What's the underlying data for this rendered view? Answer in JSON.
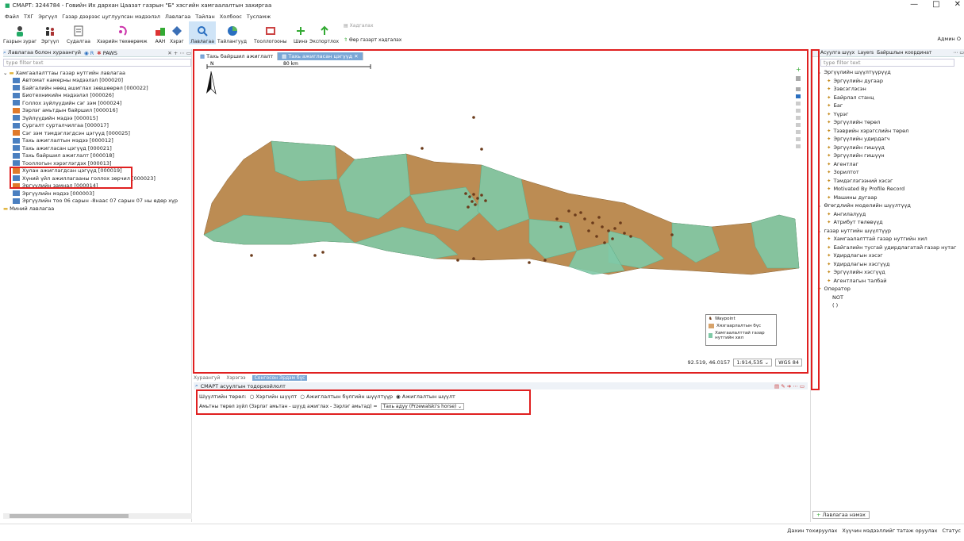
{
  "title": "СМАРТ: 3244784 - Говийн Их дархан Цаазат газрын \"Б\" хэсгийн хамгаалалтын захиргаа",
  "window_controls": [
    "—",
    "□",
    "✕"
  ],
  "menu": [
    "Файл",
    "ТХГ",
    "Эргүүл",
    "Газар дээрээс цуглуулсан мэдээлэл",
    "Лавлагаа",
    "Тайлан",
    "Холбоос",
    "Тусламж"
  ],
  "toolbar": [
    {
      "label": "Газрын зураг",
      "icon": "person-icon"
    },
    {
      "label": "Эргүүл",
      "icon": "patrol-icon"
    },
    {
      "label": "Судалгаа",
      "icon": "survey-icon"
    },
    {
      "label": "Хээрийн төхөөрөмж",
      "icon": "device-icon"
    },
    {
      "label": "ААН",
      "icon": "org-icon"
    },
    {
      "label": "Хэрэг",
      "icon": "case-icon"
    },
    {
      "label": "Лавлагаа",
      "icon": "search-icon"
    },
    {
      "label": "Тайлангууд",
      "icon": "pie-icon"
    },
    {
      "label": "Тооллогооны",
      "icon": "count-icon"
    },
    {
      "label": "Шинэ",
      "icon": "plus-icon"
    },
    {
      "label": "Экспортлох",
      "icon": "export-icon"
    },
    {
      "label": "Хадгалах",
      "icon": "save-icon"
    },
    {
      "label": "Өөр газарт хадгалах",
      "icon": "save-as-icon"
    }
  ],
  "admin_label": "Админ О",
  "left": {
    "tab_label": "Лавлагаа болон хураангүй",
    "tab2_label": "R",
    "tab3_label": "PAWS",
    "filter_placeholder": "type filter text",
    "root": "Хамгаалалттаы газар нутгийн лавлагаа",
    "items": [
      "Автомат камерны мэдээлэл [000020]",
      "Байгалийн нөөц ашиглах зөвшөөрөл [000022]",
      "Биотехникийн мэдээлэл [000026]",
      "Голлох зүйлүүдийн сэг зэм [000024]",
      "Зэрлэг амьтдын байршил [000016]",
      "Зүйлүүдийн мэдээ [000015]",
      "Сургалт сурталчилгаа [000017]",
      "Сэг зэм тэмдэглэгдсэн цэгүүд [000025]",
      "Тахь ажиглалтын мэдээ [000012]",
      "Тахь ажигласан цэгүүд [000021]",
      "Тахь байршил ажиглалт [000018]",
      "Тооллогын хэрэглэгдэх [000013]",
      "Хулан ажиглагдсан цэгүүд [000019]",
      "Хүний үйл ажиллагааны голлох зөрчил [000023]",
      "Эргүүлийн замнал [000014]",
      "Эргүүлийн мэдээ [000003]",
      "Эргүүлийн тоо 06 сарын -8наас 07 сарын 07 ны өдөр хүр"
    ],
    "my_queries": "Миний лавлагаа"
  },
  "map": {
    "tabs": [
      "Тахь байршил ажиглалт",
      "Тахь ажигласан цэгүүд"
    ],
    "scale_label": "80 km",
    "north_label": "N",
    "coords": "92.519, 46.0157",
    "scale": "1:914,535",
    "crs": "WGS 84",
    "legend": [
      {
        "label": "Waypoint",
        "color": "#6b3b1b"
      },
      {
        "label": "Хязгаарлалтын бүс",
        "color": "#d7a36b"
      },
      {
        "label": "Хамгаалалттай газар нутгийн хил",
        "color": "#7fc9a6"
      }
    ]
  },
  "bottom": {
    "tabs": [
      "Хураангуй",
      "Хэрэгээ",
      "Сонгосон Эрдэм бүс"
    ],
    "section_title": "СМАРТ асуулгын тодорхойлолт",
    "radio_label": "Шүүлтийн төрөл:",
    "radios": [
      "Хэргийн шүүлт",
      "Ажиглалтын бүлгийн шүүлтүүр",
      "Ажиглалтын шүүлт"
    ],
    "filter_text": "Амьтны төрөл зүйл (Зэрлэг амьтан - шууд ажиглах - Зэрлэг амьтад) =",
    "filter_value": "Тахь адуу (Przewalski's horse)"
  },
  "right": {
    "tabs": [
      "Асуулга шүүх",
      "Layers",
      "Байршлын координат"
    ],
    "filter_placeholder": "type filter text",
    "items": [
      "Эргүүлийн шүүлтүүрүүд",
      "Эргүүлийн дугаар",
      "Зэвсэглэсэн",
      "Байрлал станц",
      "Баг",
      "Үүрэг",
      "Эргүүлийн төрөл",
      "Тээврийн хэрэгслийн төрөл",
      "Эргүүлийн удирдагч",
      "Эргүүлийн гишүүд",
      "Эргүүлийн гишүүн",
      "Агентлаг",
      "Зорилтот",
      "Тэмдэглэгээний хэсэг",
      "Motivated By Profile Record",
      "Машины дугаар",
      "Өгөгдлийн моделийн шүүлтүүд",
      "Ангилалууд",
      "Атрибут төлөвүүд",
      "газар нутгийн шүүлтүүр",
      "Хамгаалалттай газар нутгийн хил",
      "Байгалийн тусгай удирдлагатай газар нутаг",
      "Удирдлагын хэсэг",
      "Удирдлагын хэсгүүд",
      "Эргүүлийн хэсгүүд",
      "Агентлагын талбай",
      "Оператор",
      "NOT",
      "( )"
    ],
    "add_label": "Лавлагаа нэмэх"
  },
  "status": {
    "items": [
      "Дахин тохируулах",
      "Хүүчин мэдээллийг татаж оруулах",
      "Статус"
    ]
  }
}
